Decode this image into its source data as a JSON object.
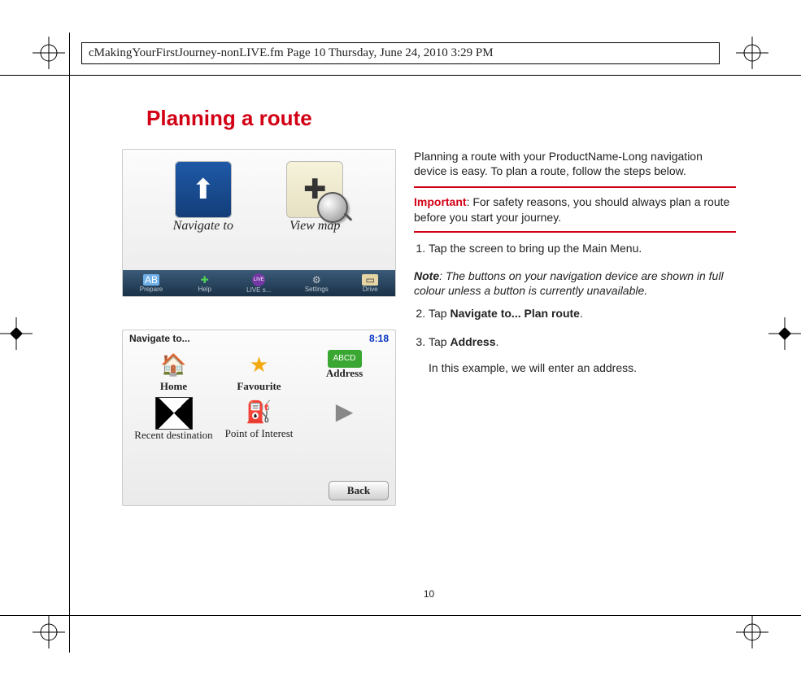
{
  "header_line": "cMakingYourFirstJourney-nonLIVE.fm  Page 10  Thursday, June 24, 2010  3:29 PM",
  "title": "Planning a route",
  "page_number": "10",
  "screenshot1": {
    "navigate_label": "Navigate to",
    "viewmap_label": "View map",
    "toolbar": {
      "prepare": "Prepare",
      "help": "Help",
      "live": "LIVE s...",
      "settings": "Settings",
      "drive": "Drive"
    }
  },
  "screenshot2": {
    "title": "Navigate to...",
    "time": "8:18",
    "items": {
      "home": "Home",
      "favourite": "Favourite",
      "address_badge": "ABCD",
      "address": "Address",
      "recent": "Recent destination",
      "poi": "Point of Interest"
    },
    "back": "Back"
  },
  "body": {
    "intro": "Planning a route with your ProductName-Long navigation device is easy. To plan a route, follow the steps below.",
    "important_label": "Important",
    "important_text": ": For safety reasons, you should always plan a route before you start your journey.",
    "step1": "Tap the screen to bring up the Main Menu.",
    "note_label": "Note",
    "note_text": ": The buttons on your navigation device are shown in full colour unless a button is currently unavailable.",
    "step2_pre": "Tap ",
    "step2_bold": "Navigate to... Plan route",
    "step2_post": ".",
    "step3_pre": "Tap ",
    "step3_bold": "Address",
    "step3_post": ".",
    "step3_follow": "In this example, we will enter an address."
  }
}
